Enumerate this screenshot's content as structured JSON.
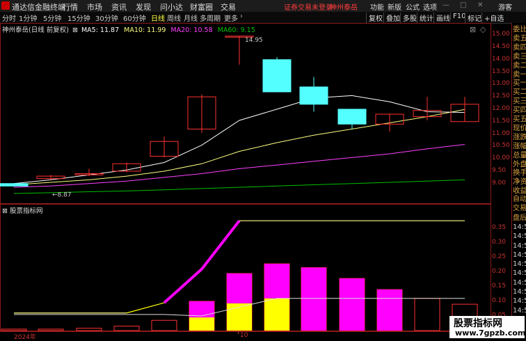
{
  "menubar": {
    "app_title": "通达信金融终端",
    "items": [
      "行情",
      "市场",
      "资讯",
      "发现",
      "问小达",
      "财富圈",
      "交易"
    ],
    "notice": "证券交易未登录",
    "stock_tag": "神州泰岳",
    "right_items": [
      "功能",
      "新版",
      "公式",
      "选项"
    ],
    "user": "游客"
  },
  "periodbar": {
    "periods": [
      "分时",
      "1分钟",
      "5分钟",
      "15分钟",
      "30分钟",
      "60分钟",
      "日线",
      "周线",
      "月线",
      "多周期",
      "更多"
    ],
    "active_period": "日线",
    "tools": [
      "复权",
      "叠加",
      "多股",
      "统计",
      "画线",
      "F10",
      "标记",
      "+自选"
    ]
  },
  "main_legend": {
    "stock": "神州泰岳(日线 前复权)",
    "ma5": "MA5: 11.87",
    "ma10": "MA10: 11.99",
    "ma20": "MA20: 10.58",
    "ma60": "MA60: 9.15"
  },
  "main_chart": {
    "high_label": "14.95",
    "low_label": "8.87",
    "y_ticks": [
      "15.00",
      "14.50",
      "14.00",
      "13.50",
      "13.00",
      "12.50",
      "12.00",
      "11.50",
      "11.00",
      "10.50",
      "10.00",
      "9.50",
      "9.00"
    ]
  },
  "sub_legend": {
    "title": "股票指标网"
  },
  "sub_chart": {
    "y_ticks": [
      "0.35",
      "0.30",
      "0.25",
      "0.20",
      "0.15",
      "0.10",
      "0.05"
    ]
  },
  "x_axis": {
    "year": "2024年",
    "month": "10"
  },
  "right_panel": {
    "labels": [
      "委比",
      "卖五",
      "卖四",
      "卖三",
      "卖二",
      "卖一",
      "买一",
      "买二",
      "买三",
      "买四",
      "买五",
      "现价",
      "涨跌",
      "涨幅",
      "总量",
      "外盘",
      "换手",
      "净资",
      "收益",
      "自动",
      "交易",
      "盘后",
      "14:5",
      "14:5",
      "14:5",
      "14:5",
      "14:5",
      "14:5",
      "14:5",
      "14:5",
      "14:5",
      "14:5"
    ]
  },
  "watermark": {
    "title": "股票指标网",
    "url": "www.7gpzb.com"
  },
  "colors": {
    "up": "#ff3232",
    "down": "#54ffff",
    "ma5": "#ffffff",
    "ma10": "#ffff80",
    "ma20": "#ff40ff",
    "ma60": "#00c000",
    "magenta": "#ff00ff",
    "yellow": "#ffff00"
  },
  "chart_data": [
    {
      "type": "candlestick",
      "title": "神州泰岳(日线 前复权)",
      "ylim": [
        8.6,
        15.2
      ],
      "candles": [
        {
          "o": 9.0,
          "c": 8.9,
          "h": 9.0,
          "l": 8.87
        },
        {
          "o": 9.2,
          "c": 9.3,
          "h": 9.35,
          "l": 9.15
        },
        {
          "o": 9.35,
          "c": 9.4,
          "h": 9.6,
          "l": 9.3
        },
        {
          "o": 9.5,
          "c": 9.8,
          "h": 9.85,
          "l": 9.45
        },
        {
          "o": 10.1,
          "c": 10.7,
          "h": 10.9,
          "l": 10.05
        },
        {
          "o": 11.2,
          "c": 12.5,
          "h": 12.6,
          "l": 11.05
        },
        {
          "o": 14.95,
          "c": 14.95,
          "h": 14.95,
          "l": 13.8
        },
        {
          "o": 14.0,
          "c": 12.7,
          "h": 14.1,
          "l": 12.7
        },
        {
          "o": 12.9,
          "c": 12.2,
          "h": 13.3,
          "l": 11.9
        },
        {
          "o": 12.0,
          "c": 11.4,
          "h": 12.0,
          "l": 11.2
        },
        {
          "o": 11.4,
          "c": 11.8,
          "h": 11.8,
          "l": 11.1
        },
        {
          "o": 11.7,
          "c": 11.95,
          "h": 12.5,
          "l": 11.55
        },
        {
          "o": 11.5,
          "c": 12.2,
          "h": 12.5,
          "l": 11.5
        }
      ],
      "series": [
        {
          "name": "MA5",
          "values": [
            9.0,
            9.15,
            9.35,
            9.55,
            9.85,
            10.55,
            11.55,
            12.0,
            12.45,
            12.55,
            12.3,
            11.9,
            11.87
          ]
        },
        {
          "name": "MA10",
          "values": [
            8.95,
            9.05,
            9.15,
            9.3,
            9.5,
            9.8,
            10.3,
            10.65,
            10.95,
            11.2,
            11.45,
            11.7,
            11.99
          ]
        },
        {
          "name": "MA20",
          "values": [
            8.85,
            8.9,
            9.0,
            9.1,
            9.25,
            9.4,
            9.6,
            9.75,
            9.9,
            10.05,
            10.2,
            10.4,
            10.58
          ]
        },
        {
          "name": "MA60",
          "values": [
            8.6,
            8.63,
            8.67,
            8.7,
            8.75,
            8.8,
            8.85,
            8.9,
            8.95,
            9.0,
            9.05,
            9.1,
            9.15
          ]
        }
      ]
    },
    {
      "type": "bar",
      "title": "股票指标网",
      "ylim": [
        0,
        0.385
      ],
      "stacked_bars": [
        {
          "total": 0.005,
          "yellow": 0,
          "magenta": 0
        },
        {
          "total": 0.005,
          "yellow": 0,
          "magenta": 0
        },
        {
          "total": 0.008,
          "yellow": 0,
          "magenta": 0
        },
        {
          "total": 0.015,
          "yellow": 0,
          "magenta": 0
        },
        {
          "total": 0.035,
          "yellow": 0,
          "magenta": 0
        },
        {
          "total": 0.1,
          "yellow": 0.045,
          "magenta": 0.055
        },
        {
          "total": 0.195,
          "yellow": 0.093,
          "magenta": 0.102
        },
        {
          "total": 0.228,
          "yellow": 0.11,
          "magenta": 0.118
        },
        {
          "total": 0.215,
          "yellow": 0,
          "magenta": 0.215
        },
        {
          "total": 0.178,
          "yellow": 0,
          "magenta": 0.178
        },
        {
          "total": 0.14,
          "yellow": 0,
          "magenta": 0.14
        },
        {
          "total": 0.11,
          "yellow": 0,
          "magenta": 0
        },
        {
          "total": 0.09,
          "yellow": 0,
          "magenta": 0
        }
      ],
      "series": [
        {
          "name": "",
          "values": [
            0.06,
            0.06,
            0.06,
            0.06,
            0.095,
            0.21,
            0.375,
            0.375,
            0.375,
            0.375,
            0.375,
            0.375,
            0.375
          ]
        },
        {
          "name": "",
          "values": [
            0.055,
            0.055,
            0.055,
            0.055,
            0.055,
            0.05,
            0.08,
            0.11,
            0.11,
            0.11,
            0.11,
            0.11,
            0.11
          ]
        }
      ]
    }
  ]
}
